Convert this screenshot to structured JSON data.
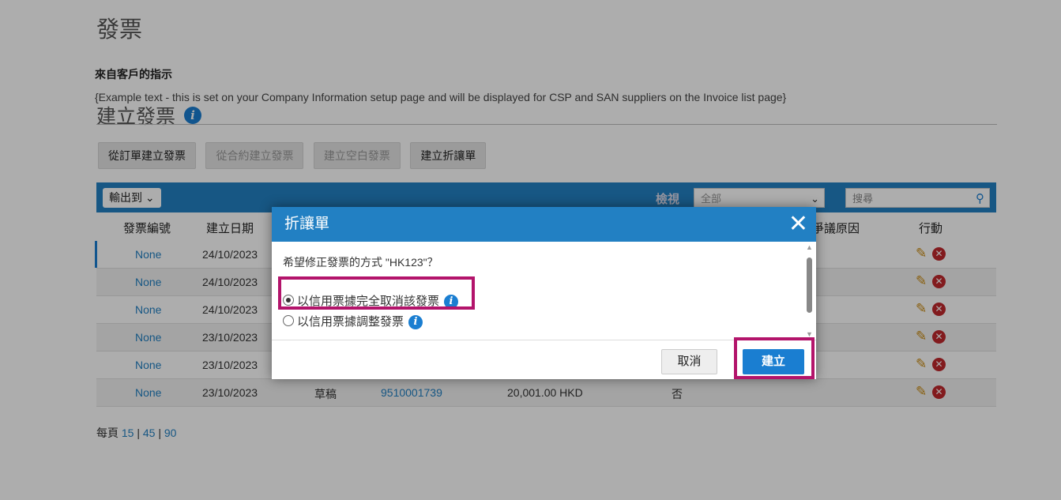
{
  "page": {
    "title": "發票",
    "instructions_title": "來自客戶的指示",
    "example_text": "{Example text - this is set on your Company Information setup page and will be displayed for CSP and SAN suppliers on the Invoice list page}",
    "section_title": "建立發票",
    "buttons": [
      "從訂單建立發票",
      "從合約建立發票",
      "建立空白發票",
      "建立折讓單"
    ]
  },
  "table": {
    "export_label": "輸出到",
    "view_label": "檢視",
    "view_value": "全部",
    "search_placeholder": "搜尋",
    "columns": {
      "invoice_no": "發票編號",
      "created": "建立日期",
      "dispute": "爭議原因",
      "actions": "行動"
    },
    "rows": [
      {
        "invoice_no": "None",
        "created": "24/10/2023"
      },
      {
        "invoice_no": "None",
        "created": "24/10/2023"
      },
      {
        "invoice_no": "None",
        "created": "24/10/2023"
      },
      {
        "invoice_no": "None",
        "created": "23/10/2023"
      },
      {
        "invoice_no": "None",
        "created": "23/10/2023"
      },
      {
        "invoice_no": "None",
        "created": "23/10/2023",
        "status": "草稿",
        "order_no": "9510001739",
        "amount": "20,001.00 HKD",
        "flag": "否"
      }
    ]
  },
  "pager": {
    "label": "每頁",
    "opt1": "15",
    "opt2": "45",
    "opt3": "90",
    "sep": "|"
  },
  "dialog": {
    "title": "折讓單",
    "close_glyph": "✕",
    "prompt": "希望修正發票的方式 \"HK123\"？",
    "option_full": "以信用票據完全取消該發票",
    "option_adjust": "以信用票據調整發票",
    "cancel": "取消",
    "create": "建立"
  },
  "icons": {
    "info": "i",
    "edit": "✎",
    "delete": "✕",
    "chevron": "⌄",
    "search": "⚲"
  },
  "colors": {
    "accent": "#2280c3",
    "highlight": "#b3146b",
    "delete": "#c0282d"
  }
}
